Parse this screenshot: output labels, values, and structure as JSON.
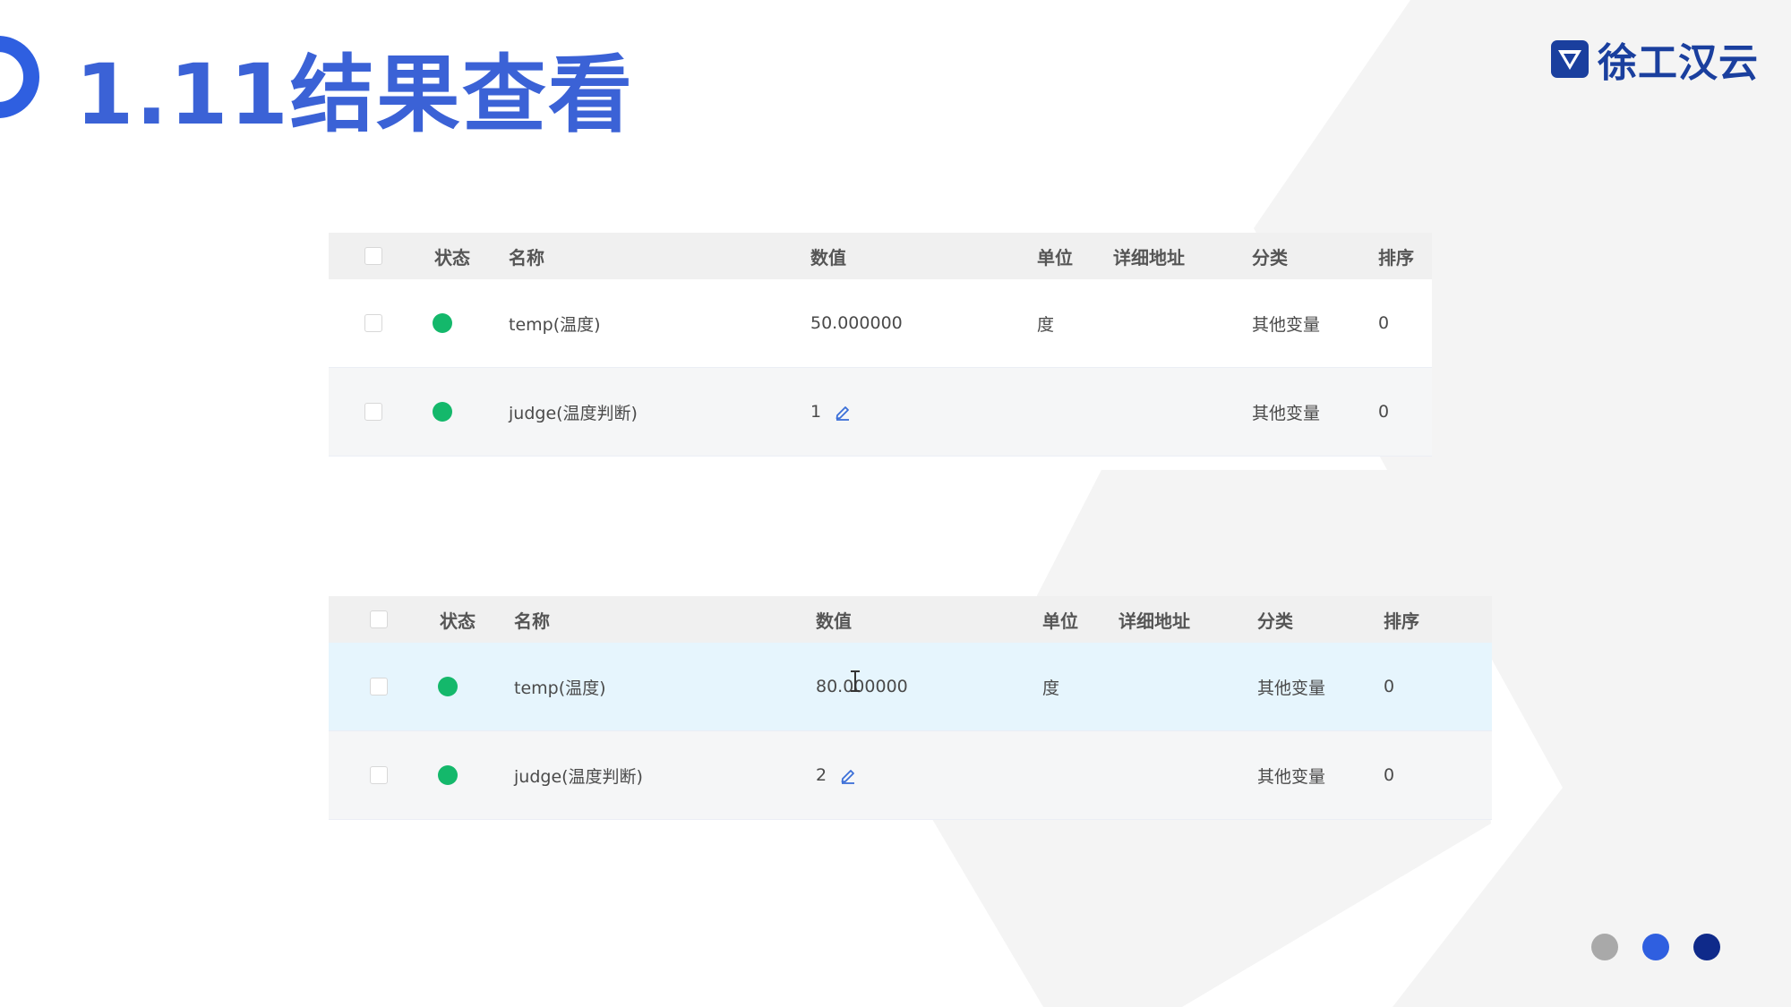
{
  "page": {
    "title": "1.11结果查看"
  },
  "brand": {
    "name": "徐工汉云"
  },
  "colors": {
    "title": "#3b62d6",
    "status_ok": "#14b86b",
    "highlight_row": "#e6f5fd",
    "header_bg": "#f0f0f0",
    "dot_gray": "#a9a9a9",
    "dot_blue": "#2f5fe0",
    "dot_navy": "#0f2a8a"
  },
  "columns": [
    "状态",
    "名称",
    "数值",
    "单位",
    "详细地址",
    "分类",
    "排序"
  ],
  "tables": [
    {
      "rows": [
        {
          "name": "temp(温度)",
          "value": "50.000000",
          "unit": "度",
          "address": "",
          "category": "其他变量",
          "order": "0",
          "editable": false
        },
        {
          "name": "judge(温度判断)",
          "value": "1",
          "unit": "",
          "address": "",
          "category": "其他变量",
          "order": "0",
          "editable": true
        }
      ]
    },
    {
      "rows": [
        {
          "name": "temp(温度)",
          "value": "80.000000",
          "unit": "度",
          "address": "",
          "category": "其他变量",
          "order": "0",
          "editable": false
        },
        {
          "name": "judge(温度判断)",
          "value": "2",
          "unit": "",
          "address": "",
          "category": "其他变量",
          "order": "0",
          "editable": true
        }
      ]
    }
  ],
  "icons": {
    "status": "status-dot-icon",
    "edit": "pencil-edit-icon",
    "cursor": "text-cursor-icon",
    "logo": "brand-logo-icon"
  },
  "pagination": {
    "dots": 3,
    "active_index": 2
  }
}
